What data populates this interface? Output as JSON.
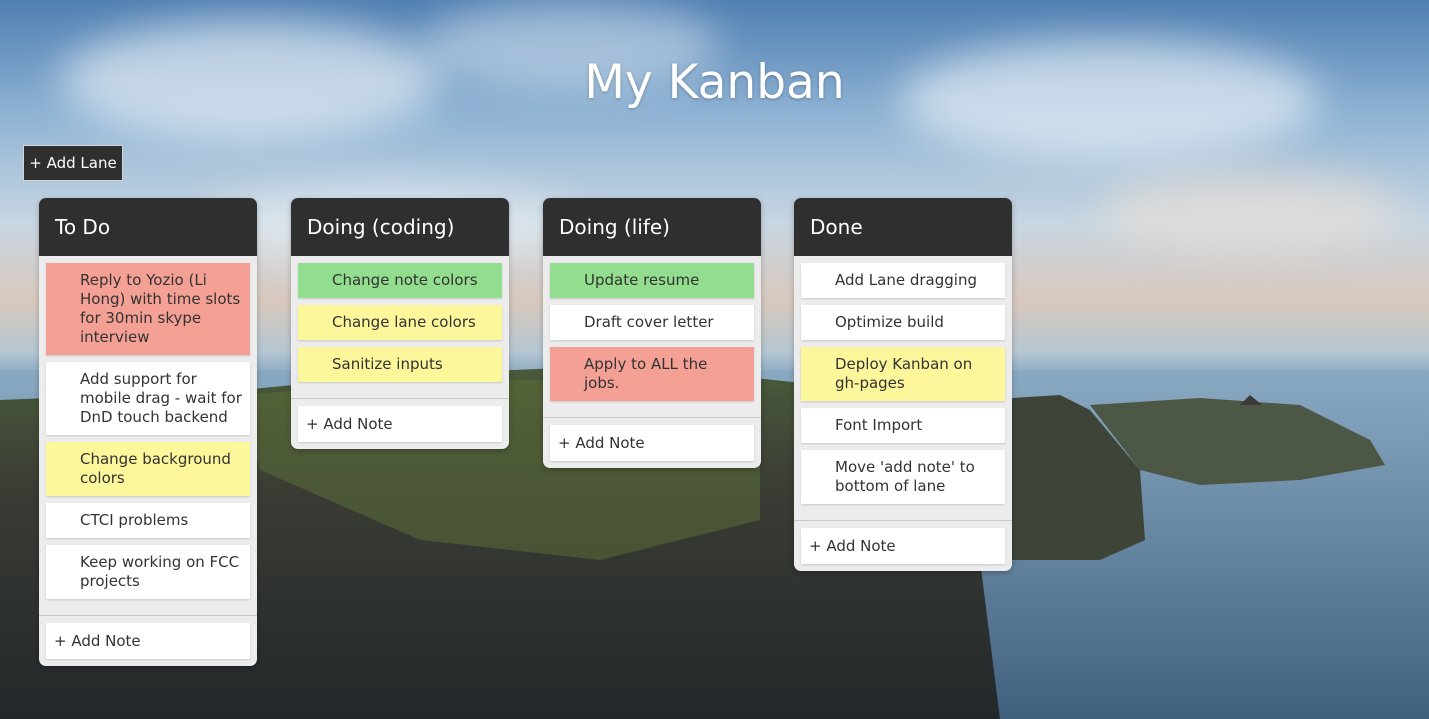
{
  "app": {
    "title": "My Kanban",
    "add_lane_label": "+ Add Lane",
    "add_note_label": "+ Add Note"
  },
  "colors": {
    "lane_header": "#2f2f2f",
    "lane_body": "#ececec",
    "note_white": "#ffffff",
    "note_red": "#f4a094",
    "note_green": "#92dd8e",
    "note_yellow": "#fdf79b"
  },
  "lanes": [
    {
      "title": "To Do",
      "notes": [
        {
          "text": "Reply to Yozio (Li Hong) with time slots for 30min skype interview",
          "color": "red"
        },
        {
          "text": "Add support for mobile drag - wait for DnD touch backend",
          "color": "white"
        },
        {
          "text": "Change background colors",
          "color": "yellow"
        },
        {
          "text": "CTCI problems",
          "color": "white"
        },
        {
          "text": "Keep working on FCC projects",
          "color": "white"
        }
      ]
    },
    {
      "title": "Doing (coding)",
      "notes": [
        {
          "text": "Change note colors",
          "color": "green"
        },
        {
          "text": "Change lane colors",
          "color": "yellow"
        },
        {
          "text": "Sanitize inputs",
          "color": "yellow"
        }
      ]
    },
    {
      "title": "Doing (life)",
      "notes": [
        {
          "text": "Update resume",
          "color": "green"
        },
        {
          "text": "Draft cover letter",
          "color": "white"
        },
        {
          "text": "Apply to ALL the jobs.",
          "color": "red"
        }
      ]
    },
    {
      "title": "Done",
      "notes": [
        {
          "text": "Add Lane dragging",
          "color": "white"
        },
        {
          "text": "Optimize build",
          "color": "white"
        },
        {
          "text": "Deploy Kanban on gh-pages",
          "color": "yellow"
        },
        {
          "text": "Font Import",
          "color": "white"
        },
        {
          "text": "Move 'add note' to bottom of lane",
          "color": "white"
        }
      ]
    }
  ]
}
